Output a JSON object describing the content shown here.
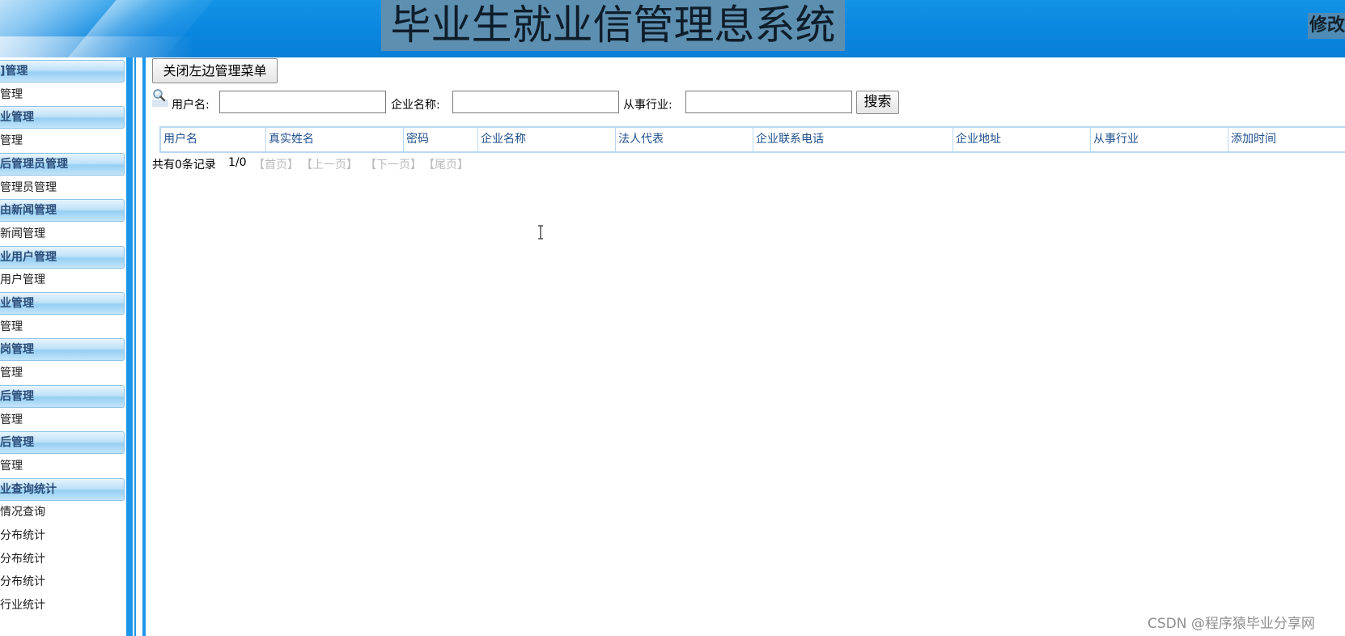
{
  "header": {
    "title": "毕业生就业信管理息系统",
    "modify_label": "修改"
  },
  "sidebar": {
    "entries": [
      {
        "type": "group",
        "label": "]管理"
      },
      {
        "type": "item",
        "label": "管理"
      },
      {
        "type": "group",
        "label": "业管理"
      },
      {
        "type": "item",
        "label": "管理"
      },
      {
        "type": "group",
        "label": "后管理员管理"
      },
      {
        "type": "item",
        "label": "管理员管理"
      },
      {
        "type": "group",
        "label": "由新闻管理"
      },
      {
        "type": "item",
        "label": "新闻管理"
      },
      {
        "type": "group",
        "label": "业用户管理"
      },
      {
        "type": "item",
        "label": "用户管理"
      },
      {
        "type": "group",
        "label": "业管理"
      },
      {
        "type": "item",
        "label": "管理"
      },
      {
        "type": "group",
        "label": "岗管理"
      },
      {
        "type": "item",
        "label": "管理"
      },
      {
        "type": "group",
        "label": "后管理"
      },
      {
        "type": "item",
        "label": "管理"
      },
      {
        "type": "group",
        "label": "后管理"
      },
      {
        "type": "item",
        "label": "管理"
      },
      {
        "type": "group",
        "label": "业查询统计"
      },
      {
        "type": "item",
        "label": "情况查询"
      },
      {
        "type": "item",
        "label": "分布统计"
      },
      {
        "type": "item",
        "label": "分布统计"
      },
      {
        "type": "item",
        "label": "分布统计"
      },
      {
        "type": "item",
        "label": "行业统计"
      }
    ]
  },
  "toolbar": {
    "close_menu_label": "关闭左边管理菜单"
  },
  "search": {
    "username_label": "用户名:",
    "username_value": "",
    "company_label": "企业名称:",
    "company_value": "",
    "industry_label": "从事行业:",
    "industry_value": "",
    "search_button_label": "搜索"
  },
  "table": {
    "columns": [
      "用户名",
      "真实姓名",
      "密码",
      "企业名称",
      "法人代表",
      "企业联系电话",
      "企业地址",
      "从事行业",
      "添加时间"
    ]
  },
  "pager": {
    "count_text": "共有0条记录",
    "page_text": "1/0",
    "first": "【首页】",
    "prev": "【上一页】",
    "next": "【下一页】",
    "last": "【尾页】"
  },
  "watermark": "CSDN @程序猿毕业分享网",
  "colors": {
    "header_blue": "#0a86df",
    "rail_blue": "#1c96ea",
    "table_border": "#b9d8f1",
    "table_header_text": "#1f4e8c",
    "disabled_link": "#b9b9b9"
  }
}
